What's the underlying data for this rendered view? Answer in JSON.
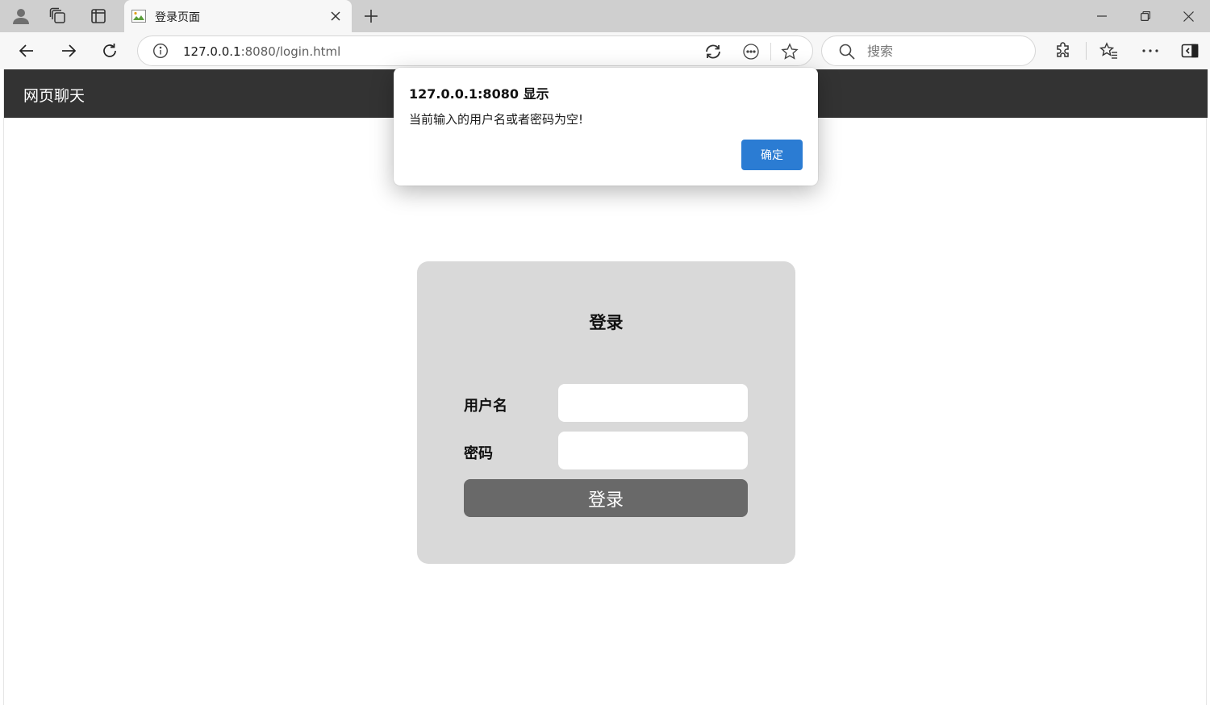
{
  "browser": {
    "tab": {
      "title": "登录页面"
    },
    "address": {
      "host": "127.0.0.1",
      "path": ":8080/login.html"
    },
    "search": {
      "placeholder": "搜索"
    }
  },
  "page": {
    "site_title": "网页聊天",
    "login": {
      "heading": "登录",
      "username_label": "用户名",
      "username_value": "",
      "password_label": "密码",
      "password_value": "",
      "submit_label": "登录"
    }
  },
  "dialog": {
    "title": "127.0.0.1:8080 显示",
    "message": "当前输入的用户名或者密码为空!",
    "ok_label": "确定"
  },
  "colors": {
    "site_nav": "#333333",
    "card": "#d9d9d9",
    "login_button": "#696969",
    "dialog_ok": "#2b7cd3"
  },
  "icons": {
    "tabbar": [
      "profile-icon",
      "workspaces-icon",
      "tab-actions-icon",
      "close-icon",
      "plus-icon"
    ],
    "window": [
      "minimize-icon",
      "restore-icon",
      "close-icon"
    ],
    "toolbar": [
      "back-arrow-icon",
      "forward-arrow-icon",
      "refresh-icon",
      "info-icon",
      "edge-app-icon",
      "more-circle-icon",
      "star-icon",
      "search-icon",
      "extensions-icon",
      "favorites-icon",
      "ellipsis-icon",
      "sidebar-icon"
    ]
  }
}
